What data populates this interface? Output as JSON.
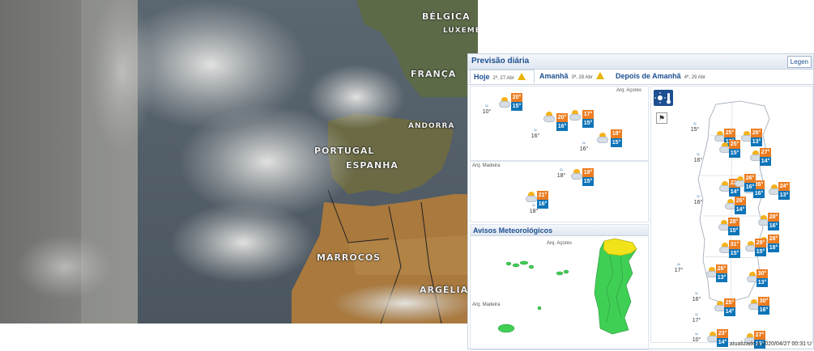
{
  "satellite": {
    "countries": [
      {
        "key": "belgica",
        "label": "BÉLGICA"
      },
      {
        "key": "luxemburgo",
        "label": "LUXEMB"
      },
      {
        "key": "franca",
        "label": "FRANÇA"
      },
      {
        "key": "andorra",
        "label": "ANDORRA"
      },
      {
        "key": "portugal",
        "label": "PORTUGAL"
      },
      {
        "key": "espanha",
        "label": "ESPANHA"
      },
      {
        "key": "marrocos",
        "label": "MARROCOS"
      },
      {
        "key": "argelia",
        "label": "ARGÉLIA"
      }
    ]
  },
  "panel": {
    "title": "Previsão diária",
    "legend_label": "Legen",
    "tabs": [
      {
        "label": "Hoje",
        "date": "2ª, 27 Abr",
        "warning": true
      },
      {
        "label": "Amanhã",
        "date": "3ª, 28 Abr",
        "warning": true
      },
      {
        "label": "Depois de Amanhã",
        "date": "4ª, 29 Abr",
        "warning": false
      }
    ],
    "azores_label": "Arq. Açores",
    "madeira_label": "Arq. Madeira",
    "azores": [
      {
        "tmax": "20°",
        "tmin": "15°"
      },
      {
        "tmax": "20°",
        "tmin": "16°"
      },
      {
        "tmax": "17°",
        "tmin": "15°"
      },
      {
        "tmax": "18°",
        "tmin": "15°"
      }
    ],
    "azores_sea": [
      "10°",
      "16°",
      "16°"
    ],
    "madeira": [
      {
        "tmax": "19°",
        "tmin": "15°"
      },
      {
        "tmax": "21°",
        "tmin": "16°"
      }
    ],
    "madeira_sea": [
      "18°",
      "18°"
    ],
    "mainland": [
      {
        "tmax": "25°",
        "tmin": "12°"
      },
      {
        "tmax": "26°",
        "tmin": "13°"
      },
      {
        "tmax": "25°",
        "tmin": "15°"
      },
      {
        "tmax": "27°",
        "tmin": "14°"
      },
      {
        "tmax": "22°",
        "tmin": "14°"
      },
      {
        "tmax": "26°",
        "tmin": "16°"
      },
      {
        "tmax": "24°",
        "tmin": "13°"
      },
      {
        "tmax": "26°",
        "tmin": "14°"
      },
      {
        "tmax": "26°",
        "tmin": "16°"
      },
      {
        "tmax": "28°",
        "tmin": "16°"
      },
      {
        "tmax": "28°",
        "tmin": "15°"
      },
      {
        "tmax": "28°",
        "tmin": "18°"
      },
      {
        "tmax": "31°",
        "tmin": "15°"
      },
      {
        "tmax": "29°",
        "tmin": "15°"
      },
      {
        "tmax": "26°",
        "tmin": "13°"
      },
      {
        "tmax": "30°",
        "tmin": "13°"
      },
      {
        "tmax": "25°",
        "tmin": "14°"
      },
      {
        "tmax": "30°",
        "tmin": "16°"
      },
      {
        "tmax": "23°",
        "tmin": "14°"
      },
      {
        "tmax": "27°",
        "tmin": "16°"
      }
    ],
    "mainland_sea": [
      "15°",
      "16°",
      "16°",
      "17°",
      "16°",
      "17°",
      "10°"
    ],
    "warnings_title": "Avisos Meteorológicos",
    "warnings_azores_label": "Arq. Açores",
    "warnings_madeira_label": "Arq. Madeira",
    "updated": "atualizado a 2020/04/27 00:31 U"
  },
  "colors": {
    "max_temp": "#ec7d21",
    "min_temp": "#0e74b8",
    "warning_green": "#3fcf55",
    "warning_yellow": "#f1e21a"
  }
}
